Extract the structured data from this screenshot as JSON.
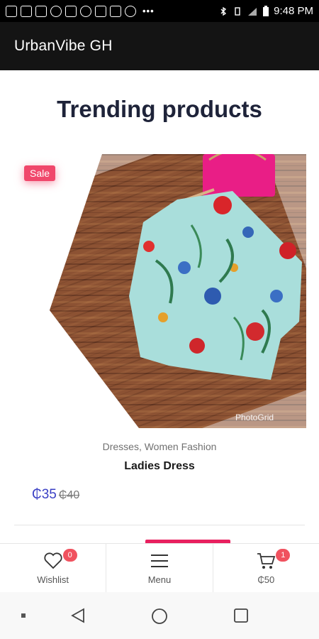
{
  "status_bar": {
    "time": "9:48 PM"
  },
  "app_bar": {
    "title": "UrbanVibe GH"
  },
  "section": {
    "title": "Trending products"
  },
  "product": {
    "badge": "Sale",
    "categories": "Dresses,  Women Fashion",
    "name": "Ladies Dress",
    "price": "₵35",
    "old_price": "₵40",
    "watermark": "PhotoGrid"
  },
  "bottom_nav": {
    "wishlist": {
      "label": "Wishlist",
      "badge": "0",
      "icon": "heart-icon"
    },
    "menu": {
      "label": "Menu",
      "icon": "hamburger-menu-icon"
    },
    "cart": {
      "label": "₵50",
      "badge": "1",
      "icon": "cart-icon"
    }
  },
  "colors": {
    "accent": "#3a3fc4",
    "sale": "#f0476b",
    "badge": "#f0525f",
    "title": "#1e2339",
    "app_bar": "#141414"
  }
}
